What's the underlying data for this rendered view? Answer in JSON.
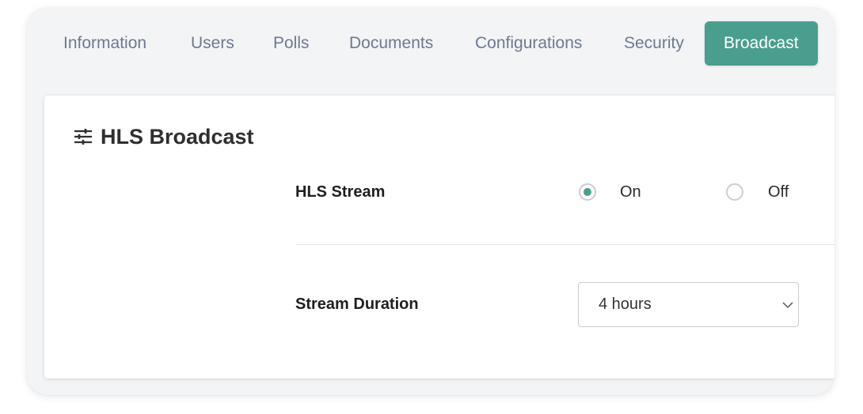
{
  "tabs": [
    {
      "label": "Information",
      "active": false
    },
    {
      "label": "Users",
      "active": false
    },
    {
      "label": "Polls",
      "active": false
    },
    {
      "label": "Documents",
      "active": false
    },
    {
      "label": "Configurations",
      "active": false
    },
    {
      "label": "Security",
      "active": false
    },
    {
      "label": "Broadcast",
      "active": true
    }
  ],
  "section": {
    "title": "HLS Broadcast",
    "icon": "sliders-icon"
  },
  "hls_stream": {
    "label": "HLS Stream",
    "options": [
      {
        "label": "On",
        "selected": true
      },
      {
        "label": "Off",
        "selected": false
      }
    ]
  },
  "stream_duration": {
    "label": "Stream Duration",
    "value": "4 hours"
  },
  "colors": {
    "accent": "#4a9e8e",
    "tab_text": "#6b7a8f",
    "background": "#f3f4f6"
  }
}
